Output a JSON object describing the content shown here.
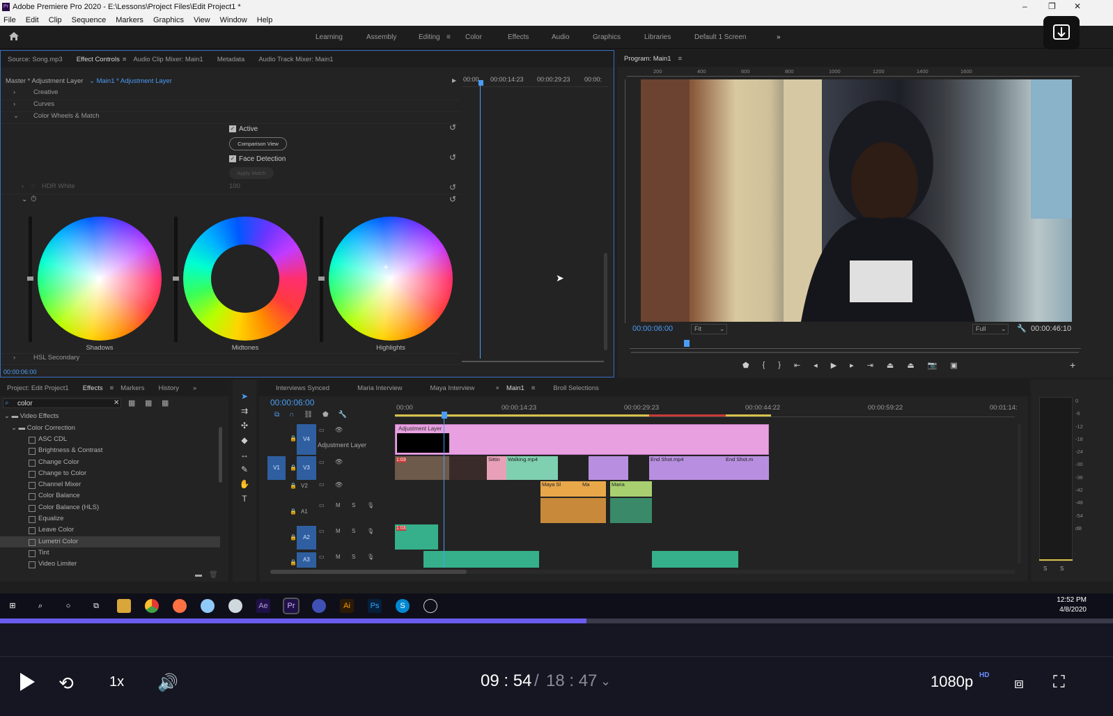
{
  "window": {
    "title": "Adobe Premiere Pro 2020 - E:\\Lessons\\Project Files\\Edit Project1 *",
    "min": "–",
    "max": "❐",
    "close": "✕"
  },
  "menu": [
    "File",
    "Edit",
    "Clip",
    "Sequence",
    "Markers",
    "Graphics",
    "View",
    "Window",
    "Help"
  ],
  "workspaces": [
    "Learning",
    "Assembly",
    "Editing",
    "Color",
    "Effects",
    "Audio",
    "Graphics",
    "Libraries",
    "Default 1 Screen"
  ],
  "workspace_more": "»",
  "source_tabs": [
    "Source: Song.mp3",
    "Effect Controls",
    "Audio Clip Mixer: Main1",
    "Metadata",
    "Audio Track Mixer: Main1"
  ],
  "effect_controls": {
    "master": "Master * Adjustment Layer",
    "seq": "Main1 * Adjustment Layer",
    "times": [
      "00:00",
      "00:00:14:23",
      "00:00:29:23",
      "00:00:"
    ],
    "rows": [
      "Creative",
      "Curves",
      "Color Wheels & Match"
    ],
    "active": "Active",
    "comparison": "Comparison View",
    "face": "Face Detection",
    "apply": "Apply Match",
    "hdr": "HDR White",
    "hdr_val": "100",
    "wheels": [
      "Shadows",
      "Midtones",
      "Highlights"
    ],
    "hsl": "HSL Secondary",
    "timecode": "00:00:06:00"
  },
  "program": {
    "title": "Program: Main1",
    "ruler": [
      "200",
      "400",
      "600",
      "800",
      "1000",
      "1200",
      "1400",
      "1600"
    ],
    "timecode": "00:00:06:00",
    "fit": "Fit",
    "full": "Full",
    "duration": "00:00:46:10"
  },
  "project_tabs": [
    "Project: Edit Project1",
    "Effects",
    "Markers",
    "History"
  ],
  "search": "color",
  "effects_tree": {
    "root": "Video Effects",
    "folder": "Color Correction",
    "items": [
      "ASC CDL",
      "Brightness & Contrast",
      "Change Color",
      "Change to Color",
      "Channel Mixer",
      "Color Balance",
      "Color Balance (HLS)",
      "Equalize",
      "Leave Color",
      "Lumetri Color",
      "Tint",
      "Video Limiter"
    ],
    "selected": "Lumetri Color"
  },
  "timeline": {
    "tabs": [
      "Interviews Synced",
      "Maria Interview",
      "Maya Interview",
      "Main1",
      "Broll Selections"
    ],
    "timecode": "00:00:06:00",
    "ruler": [
      "00:00",
      "00:00:14:23",
      "00:00:29:23",
      "00:00:44:22",
      "00:00:59:22",
      "00:01:14:"
    ],
    "tracks": [
      "V4",
      "V3",
      "V2",
      "A1",
      "A2",
      "A3"
    ],
    "adjustment": "Adjustment Layer",
    "clips": {
      "adj": "Adjustment Layer",
      "sittin": "Sittin",
      "walking": "Walking.mp4",
      "endshot": "End Shot.mp4",
      "endshot2": "End Shot.m",
      "mayas": "Maya Sl",
      "ma": "Ma",
      "maria": "Maria",
      "a2": "1:03",
      "v3tag": "1:03"
    }
  },
  "meter": [
    "0",
    "-6",
    "-12",
    "-18",
    "-24",
    "-30",
    "-36",
    "-42",
    "-48",
    "-54",
    "dB"
  ],
  "meter_solo": [
    "S",
    "S"
  ],
  "taskbar": {
    "time": "12:52 PM",
    "date": "4/8/2020",
    "apps": [
      "Ae",
      "Pr",
      "Ai",
      "Ps",
      "S"
    ]
  },
  "player": {
    "current": "09 : 54",
    "sep": "/",
    "total": "18 : 47",
    "speed": "1x",
    "quality": "1080p",
    "hd": "HD",
    "progress": 0.527
  },
  "colors": {
    "accent": "#4b9cf5",
    "adjclip": "#e8a0e0",
    "v3clip": "#b88fe0",
    "greenclip": "#35b08a",
    "orangeclip": "#e8a84a"
  }
}
